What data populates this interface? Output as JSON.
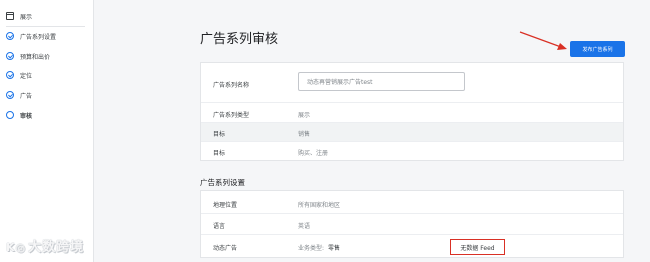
{
  "sidebar": {
    "header": "展示",
    "items": [
      {
        "label": "广告系列设置",
        "icon": "check-circle-icon"
      },
      {
        "label": "预算和出价",
        "icon": "check-circle-icon"
      },
      {
        "label": "定位",
        "icon": "check-circle-icon"
      },
      {
        "label": "广告",
        "icon": "check-circle-icon"
      },
      {
        "label": "审核",
        "icon": "empty-circle-icon"
      }
    ]
  },
  "watermark": "大数跨境",
  "page": {
    "title": "广告系列审核",
    "publish_button": "发布广告系列"
  },
  "campaign": {
    "rows": [
      {
        "label": "广告系列名称",
        "value": "动态再营销展示广告test"
      },
      {
        "label": "广告系列类型",
        "value": "展示"
      },
      {
        "label": "目标",
        "value": "销售"
      },
      {
        "label": "目标",
        "value": "购买、注册"
      }
    ]
  },
  "settings": {
    "title": "广告系列设置",
    "rows": [
      {
        "label": "地理位置",
        "value": "所有国家和地区"
      },
      {
        "label": "语言",
        "value": "英语"
      },
      {
        "label": "动态广告",
        "biz_label": "业务类型:",
        "biz_value": "零售",
        "feed": "无数据 Feed"
      }
    ]
  },
  "colors": {
    "accent": "#1a73e8",
    "highlight": "#d93025"
  }
}
